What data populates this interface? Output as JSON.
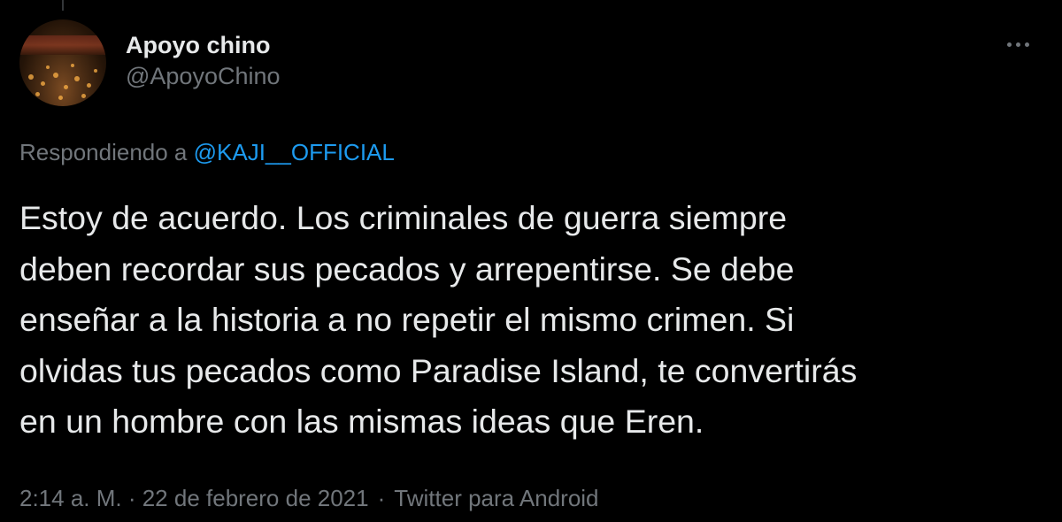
{
  "author": {
    "display_name": "Apoyo chino",
    "handle": "@ApoyoChino",
    "avatar_icon": "avatar-photo-candles"
  },
  "reply": {
    "prefix": "Respondiendo a",
    "mention": "@KAJI__OFFICIAL"
  },
  "tweet": {
    "text": "Estoy de acuerdo. Los criminales de guerra siempre\ndeben recordar sus pecados y arrepentirse. Se debe\nenseñar a la historia a no repetir el mismo crimen. Si\nolvidas tus pecados como Paradise Island, te convertirás\nen un hombre con las mismas ideas que Eren."
  },
  "meta": {
    "timestamp": "2:14 a. M. · 22 de febrero de 2021",
    "separator": "·",
    "source": "Twitter para Android"
  },
  "icons": {
    "more": "more-horizontal-icon"
  },
  "colors": {
    "background": "#000000",
    "primary_text": "#e7e9ea",
    "secondary_text": "#71767b",
    "link": "#1d9bf0"
  }
}
